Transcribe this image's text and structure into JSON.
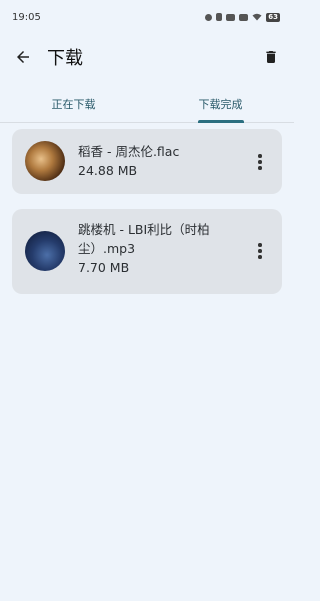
{
  "status_bar": {
    "time": "19:05",
    "battery": "63",
    "icons": [
      "shield-icon",
      "vibrate-icon",
      "hd-icon",
      "signal-icon",
      "wifi-icon",
      "battery-icon"
    ]
  },
  "header": {
    "title": "下载",
    "back_icon": "arrow-back-icon",
    "delete_icon": "trash-icon"
  },
  "tabs": [
    {
      "label": "正在下载",
      "active": false
    },
    {
      "label": "下载完成",
      "active": true
    }
  ],
  "downloads": [
    {
      "title": "稻香 - 周杰伦.flac",
      "size": "24.88 MB"
    },
    {
      "title": "跳楼机 - LBI利比（时柏尘）.mp3",
      "size": "7.70 MB"
    }
  ],
  "colors": {
    "background": "#eef4fb",
    "card": "#dfe3e8",
    "tab_accent": "#2b6f80"
  }
}
